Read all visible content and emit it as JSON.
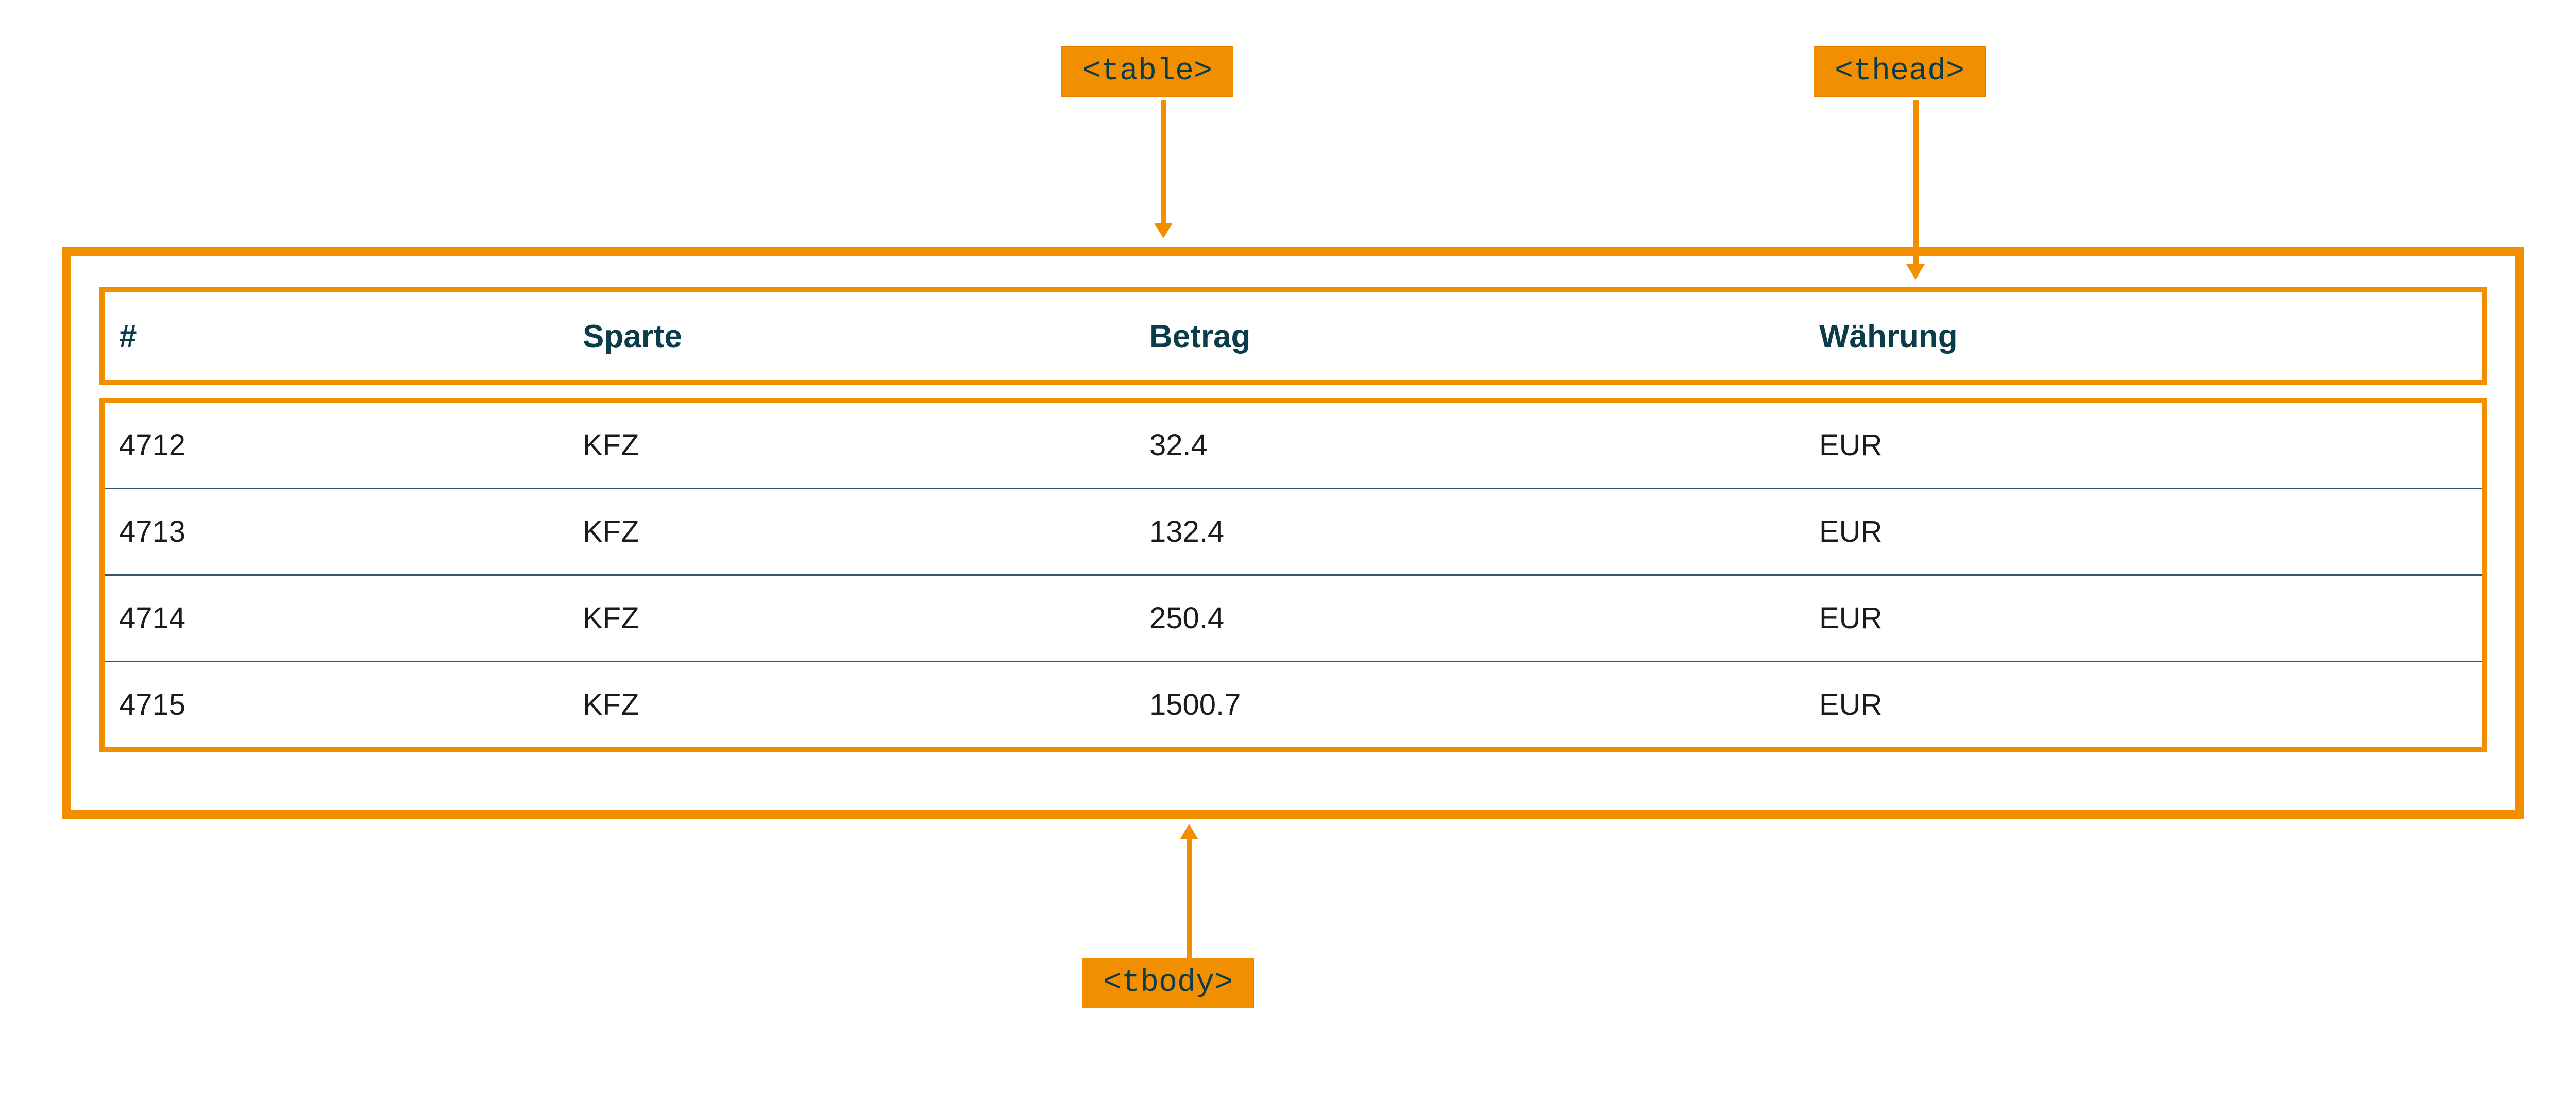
{
  "callouts": {
    "table": "<table>",
    "thead": "<thead>",
    "tbody": "<tbody>"
  },
  "table": {
    "headers": {
      "id": "#",
      "sparte": "Sparte",
      "betrag": "Betrag",
      "waehrung": "Währung"
    },
    "rows": [
      {
        "id": "4712",
        "sparte": "KFZ",
        "betrag": "32.4",
        "waehrung": "EUR"
      },
      {
        "id": "4713",
        "sparte": "KFZ",
        "betrag": "132.4",
        "waehrung": "EUR"
      },
      {
        "id": "4714",
        "sparte": "KFZ",
        "betrag": "250.4",
        "waehrung": "EUR"
      },
      {
        "id": "4715",
        "sparte": "KFZ",
        "betrag": "1500.7",
        "waehrung": "EUR"
      }
    ]
  },
  "colors": {
    "orange": "#F18F01",
    "teal": "#0B3C49"
  }
}
